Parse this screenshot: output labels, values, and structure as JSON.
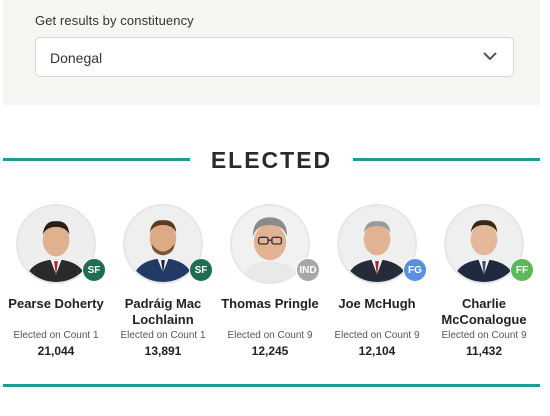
{
  "filter": {
    "label": "Get results by constituency",
    "selected": "Donegal"
  },
  "section": {
    "heading": "ELECTED"
  },
  "colors": {
    "accent": "#1f9b97",
    "SF": "#1f6e52",
    "IND": "#a7a7a7",
    "FG": "#5a8fe0",
    "FF": "#5cb85c"
  },
  "candidates": [
    {
      "name": "Pearse Doherty",
      "party": "SF",
      "count_text": "Elected on Count 1",
      "votes": "21,044"
    },
    {
      "name": "Padráig Mac Lochlainn",
      "party": "SF",
      "count_text": "Elected on Count 1",
      "votes": "13,891"
    },
    {
      "name": "Thomas Pringle",
      "party": "IND",
      "count_text": "Elected on Count 9",
      "votes": "12,245"
    },
    {
      "name": "Joe McHugh",
      "party": "FG",
      "count_text": "Elected on Count 9",
      "votes": "12,104"
    },
    {
      "name": "Charlie McConalogue",
      "party": "FF",
      "count_text": "Elected on Count 9",
      "votes": "11,432"
    }
  ]
}
